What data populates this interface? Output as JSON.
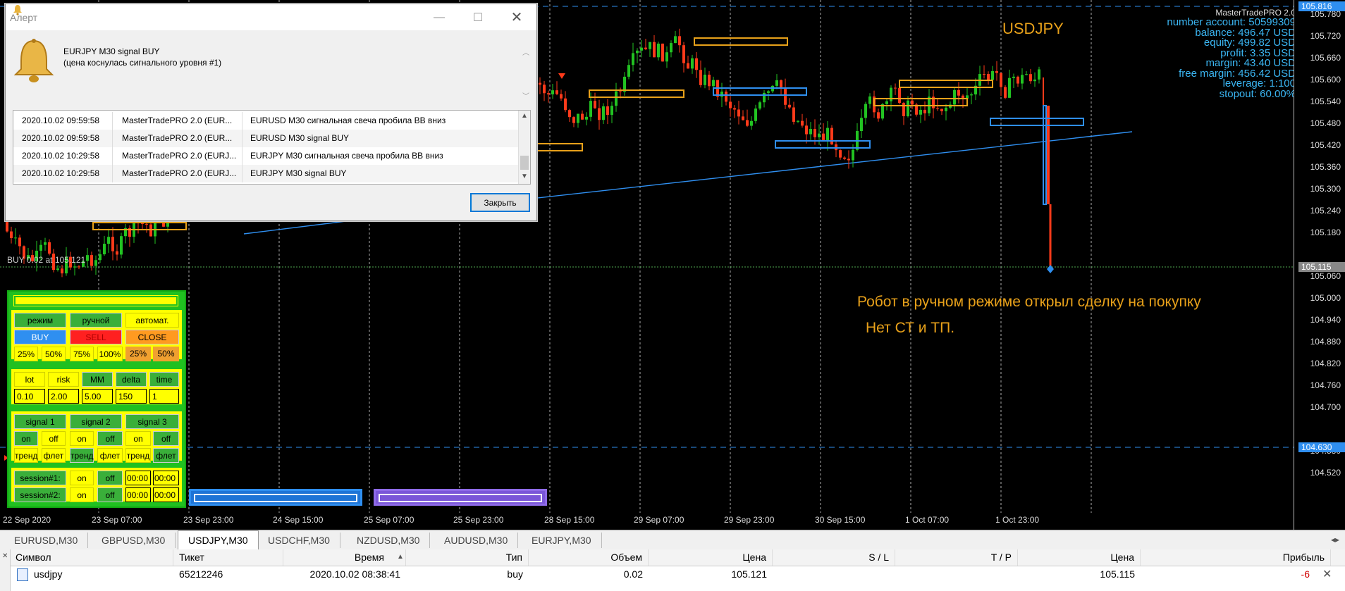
{
  "chart": {
    "symbol": "USDJPY",
    "buy_line_label": "BUY 0.02 at 105.121",
    "note_line1": "Робот в ручном режиме открыл сделку на покупку",
    "note_line2": "Нет СТ и ТП.",
    "price_labels": [
      "105.780",
      "105.720",
      "105.660",
      "105.600",
      "105.540",
      "105.480",
      "105.420",
      "105.360",
      "105.300",
      "105.240",
      "105.180",
      "105.060",
      "105.000",
      "104.940",
      "104.880",
      "104.820",
      "104.760",
      "104.700",
      "104.580",
      "104.520"
    ],
    "price_boxes": {
      "top": "105.816",
      "current": "105.115",
      "low": "104.630"
    },
    "time_labels": [
      "22 Sep 2020",
      "23 Sep 07:00",
      "23 Sep 23:00",
      "24 Sep 15:00",
      "25 Sep 07:00",
      "25 Sep 23:00",
      "28 Sep 15:00",
      "29 Sep 07:00",
      "29 Sep 23:00",
      "30 Sep 15:00",
      "1 Oct 07:00",
      "1 Oct 23:00"
    ],
    "colors": {
      "bull": "#22c322",
      "bear": "#ff3a1a",
      "trendline": "#2f8ff0",
      "accent": "#e8a11a",
      "account": "#3bb6f3"
    }
  },
  "account": {
    "title": "MasterTradePRO 2.0",
    "lines": [
      "number account: 50599309",
      "balance: 496.47 USD",
      "equity: 499.82 USD",
      "profit: 3.35 USD",
      "margin: 43.40 USD",
      "free margin: 456.42 USD",
      "leverage: 1:100",
      "stopout: 60.00%"
    ]
  },
  "alert": {
    "title": "Алерт",
    "message_line1": "EURJPY M30 signal BUY",
    "message_line2": "(цена коснулась сигнального уровня #1)",
    "rows": [
      {
        "time": "2020.10.02 09:59:58",
        "source": "MasterTradePRO 2.0 (EUR...",
        "text": "EURUSD M30 сигнальная свеча пробила ВВ вниз"
      },
      {
        "time": "2020.10.02 09:59:58",
        "source": "MasterTradePRO 2.0 (EUR...",
        "text": "EURUSD M30 signal BUY"
      },
      {
        "time": "2020.10.02 10:29:58",
        "source": "MasterTradePRO 2.0 (EURJ...",
        "text": "EURJPY M30 сигнальная свеча пробила ВВ вниз"
      },
      {
        "time": "2020.10.02 10:29:58",
        "source": "MasterTradePRO 2.0 (EURJ...",
        "text": "EURJPY M30 signal BUY"
      }
    ],
    "close_label": "Закрыть"
  },
  "panel": {
    "mode_label": "режим",
    "manual_label": "ручной",
    "auto_label": "автомат.",
    "buy_label": "BUY",
    "sell_label": "SELL",
    "close_label": "CLOSE",
    "percents": [
      "25%",
      "50%",
      "75%",
      "100%",
      "25%",
      "50%"
    ],
    "param_labels": [
      "lot",
      "risk",
      "MM",
      "delta",
      "time"
    ],
    "param_values": [
      "0.10",
      "2.00",
      "5.00",
      "150",
      "1"
    ],
    "signals": [
      "signal 1",
      "signal 2",
      "signal 3"
    ],
    "onoff": [
      "on",
      "off",
      "on",
      "off",
      "on",
      "off"
    ],
    "modes": [
      "тренд",
      "флет",
      "тренд",
      "флет",
      "тренд",
      "флет"
    ],
    "sessions": [
      {
        "label": "session#1:",
        "on": "on",
        "off": "off",
        "from": "00:00",
        "to": "00:00"
      },
      {
        "label": "session#2:",
        "on": "on",
        "off": "off",
        "from": "00:00",
        "to": "00:00"
      }
    ]
  },
  "tabs": [
    "EURUSD,M30",
    "GBPUSD,M30",
    "USDJPY,M30",
    "USDCHF,M30",
    "NZDUSD,M30",
    "AUDUSD,M30",
    "EURJPY,M30"
  ],
  "active_tab": "USDJPY,M30",
  "trade_table": {
    "headers": [
      "Символ",
      "Тикет",
      "Время",
      "Тип",
      "Объем",
      "Цена",
      "S / L",
      "T / P",
      "Цена",
      "Прибыль"
    ],
    "row": {
      "symbol": "usdjpy",
      "ticket": "65212246",
      "time": "2020.10.02 08:38:41",
      "type": "buy",
      "volume": "0.02",
      "price": "105.121",
      "sl": "",
      "tp": "",
      "cur_price": "105.115",
      "profit": "-6"
    }
  }
}
